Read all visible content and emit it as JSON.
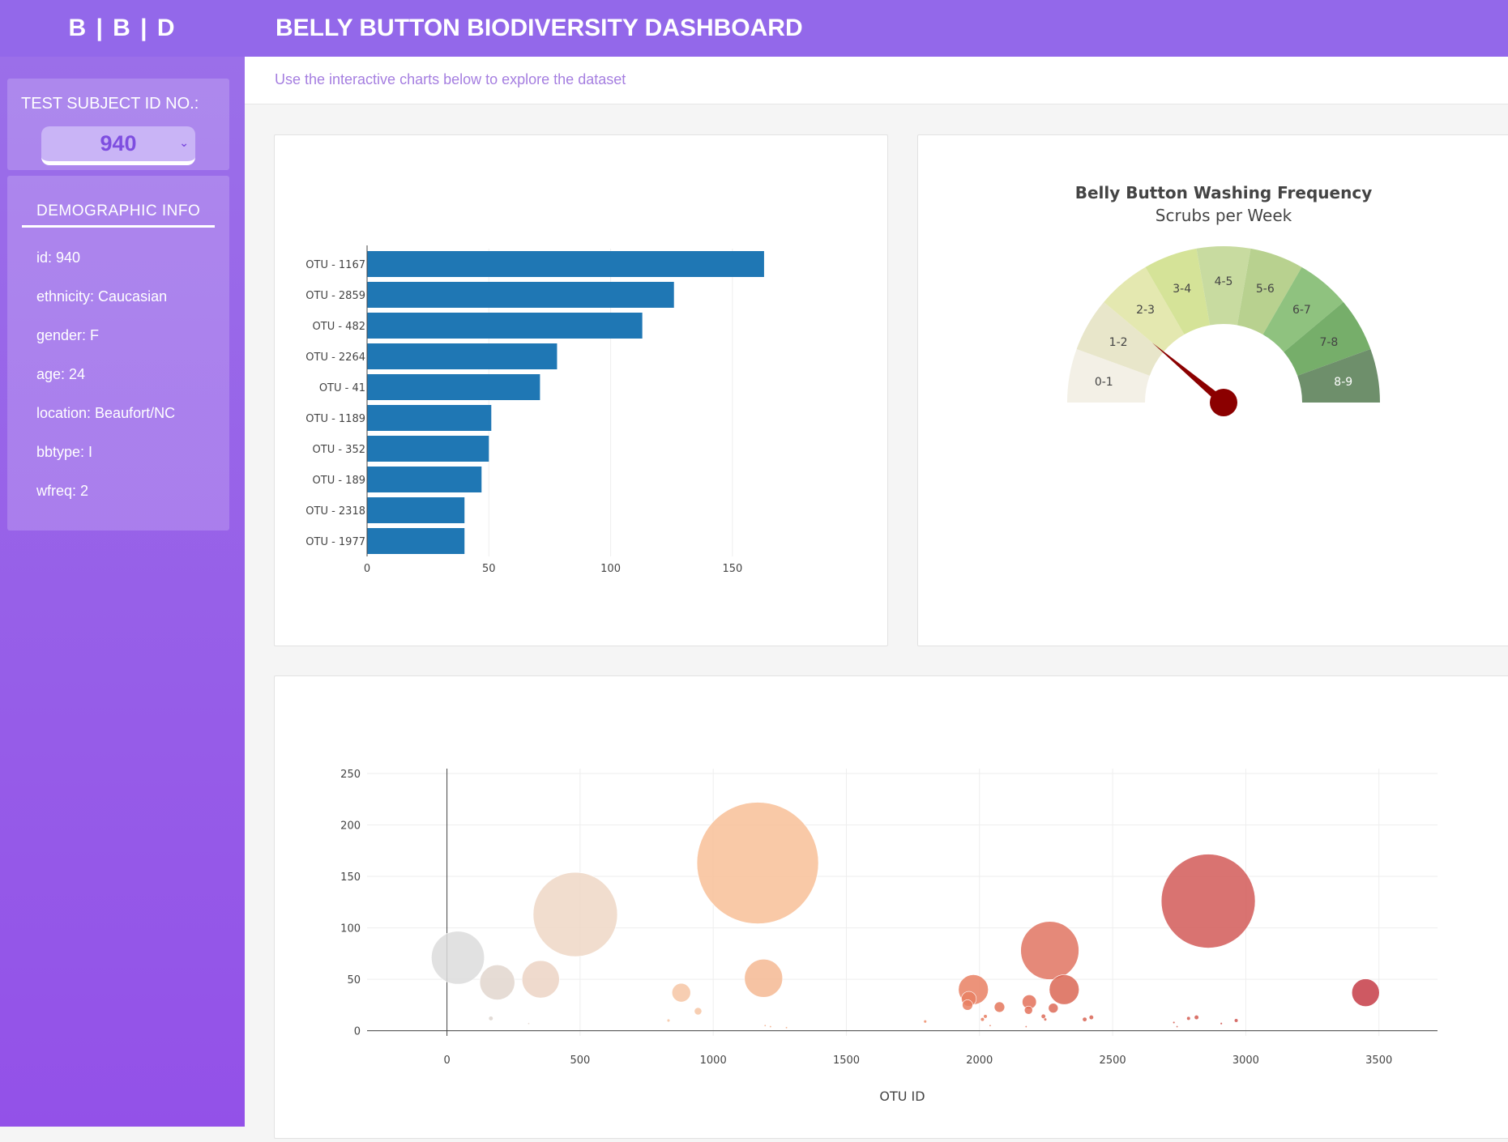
{
  "header": {
    "brand": "B | B | D",
    "title": "BELLY BUTTON BIODIVERSITY DASHBOARD"
  },
  "intro": "Use the interactive charts below to explore the dataset",
  "sidebar": {
    "subject_label": "TEST SUBJECT ID NO.:",
    "selected_id": "940",
    "demo_title": "DEMOGRAPHIC INFO",
    "demographics": [
      "id: 940",
      "ethnicity: Caucasian",
      "gender: F",
      "age: 24",
      "location: Beaufort/NC",
      "bbtype: I",
      "wfreq: 2"
    ]
  },
  "colors": {
    "header": "#9368ea",
    "bar": "#1f77b4",
    "needle": "#8b0000"
  },
  "chart_data": [
    {
      "type": "bar",
      "orientation": "horizontal",
      "categories": [
        "OTU - 1167",
        "OTU - 2859",
        "OTU - 482",
        "OTU - 2264",
        "OTU - 41",
        "OTU - 1189",
        "OTU - 352",
        "OTU - 189",
        "OTU - 2318",
        "OTU - 1977"
      ],
      "values": [
        163,
        126,
        113,
        78,
        71,
        51,
        50,
        47,
        40,
        40
      ],
      "xlim": [
        0,
        175
      ],
      "xticks": [
        0,
        50,
        100,
        150
      ]
    },
    {
      "type": "gauge",
      "title": "Belly Button Washing Frequency",
      "subtitle": "Scrubs per Week",
      "segments": [
        "0-1",
        "1-2",
        "2-3",
        "3-4",
        "4-5",
        "5-6",
        "6-7",
        "7-8",
        "8-9"
      ],
      "segment_colors": [
        "#f3f0e6",
        "#e8e6ca",
        "#e4e8b0",
        "#d5e398",
        "#c8dba0",
        "#b8d18f",
        "#8fc27f",
        "#76ae6a",
        "#6e8f6b"
      ],
      "value": 2,
      "range": [
        0,
        9
      ]
    },
    {
      "type": "scatter",
      "bubble": true,
      "xlabel": "OTU ID",
      "xlim": [
        -300,
        3720
      ],
      "ylim": [
        -5,
        250
      ],
      "xticks": [
        0,
        500,
        1000,
        1500,
        2000,
        2500,
        3000,
        3500
      ],
      "yticks": [
        0,
        50,
        100,
        150,
        200,
        250
      ],
      "points": [
        {
          "x": 41,
          "y": 71,
          "s": 71,
          "c": "#dcdcdc"
        },
        {
          "x": 189,
          "y": 47,
          "s": 47,
          "c": "#e2d6ce"
        },
        {
          "x": 352,
          "y": 50,
          "s": 50,
          "c": "#ecd4c4"
        },
        {
          "x": 482,
          "y": 113,
          "s": 113,
          "c": "#efd7c6"
        },
        {
          "x": 165,
          "y": 12,
          "s": 6,
          "c": "#ddd5cf"
        },
        {
          "x": 307,
          "y": 7,
          "s": 2,
          "c": "#e6d8cf"
        },
        {
          "x": 880,
          "y": 37,
          "s": 25,
          "c": "#f6c6a4"
        },
        {
          "x": 943,
          "y": 19,
          "s": 10,
          "c": "#f6c6a4"
        },
        {
          "x": 832,
          "y": 10,
          "s": 4,
          "c": "#f6c6a4"
        },
        {
          "x": 1167,
          "y": 163,
          "s": 163,
          "c": "#f8bf98"
        },
        {
          "x": 1189,
          "y": 51,
          "s": 51,
          "c": "#f5b993"
        },
        {
          "x": 1195,
          "y": 5,
          "s": 2,
          "c": "#f2a882"
        },
        {
          "x": 1215,
          "y": 4,
          "s": 1,
          "c": "#f2a882"
        },
        {
          "x": 1275,
          "y": 3,
          "s": 1,
          "c": "#f2a882"
        },
        {
          "x": 1796,
          "y": 9,
          "s": 4,
          "c": "#ed8e6c"
        },
        {
          "x": 1977,
          "y": 40,
          "s": 40,
          "c": "#e98063"
        },
        {
          "x": 1960,
          "y": 31,
          "s": 20,
          "c": "#e98063"
        },
        {
          "x": 1955,
          "y": 25,
          "s": 14,
          "c": "#e98063"
        },
        {
          "x": 2011,
          "y": 11,
          "s": 5,
          "c": "#e77c5f"
        },
        {
          "x": 2022,
          "y": 14,
          "s": 5,
          "c": "#e77c5f"
        },
        {
          "x": 2040,
          "y": 5,
          "s": 1,
          "c": "#e77c5f"
        },
        {
          "x": 2075,
          "y": 23,
          "s": 14,
          "c": "#e4775c"
        },
        {
          "x": 2175,
          "y": 4,
          "s": 2,
          "c": "#e3715a"
        },
        {
          "x": 2187,
          "y": 28,
          "s": 19,
          "c": "#e3715a"
        },
        {
          "x": 2184,
          "y": 20,
          "s": 11,
          "c": "#e3715a"
        },
        {
          "x": 2264,
          "y": 78,
          "s": 78,
          "c": "#e07461"
        },
        {
          "x": 2240,
          "y": 14,
          "s": 6,
          "c": "#dd6b58"
        },
        {
          "x": 2247,
          "y": 11,
          "s": 4,
          "c": "#dd6b58"
        },
        {
          "x": 2277,
          "y": 22,
          "s": 13,
          "c": "#dd6b58"
        },
        {
          "x": 2318,
          "y": 40,
          "s": 40,
          "c": "#db6755"
        },
        {
          "x": 2395,
          "y": 11,
          "s": 6,
          "c": "#d86453"
        },
        {
          "x": 2420,
          "y": 13,
          "s": 6,
          "c": "#d86453"
        },
        {
          "x": 2730,
          "y": 8,
          "s": 3,
          "c": "#d35a50"
        },
        {
          "x": 2742,
          "y": 4,
          "s": 1,
          "c": "#d35a50"
        },
        {
          "x": 2785,
          "y": 12,
          "s": 5,
          "c": "#d35a50"
        },
        {
          "x": 2815,
          "y": 13,
          "s": 6,
          "c": "#d35a50"
        },
        {
          "x": 2859,
          "y": 126,
          "s": 126,
          "c": "#d25a58"
        },
        {
          "x": 2908,
          "y": 7,
          "s": 3,
          "c": "#cf5550"
        },
        {
          "x": 2964,
          "y": 10,
          "s": 5,
          "c": "#cf5550"
        },
        {
          "x": 3450,
          "y": 37,
          "s": 37,
          "c": "#c63c46"
        }
      ]
    }
  ]
}
